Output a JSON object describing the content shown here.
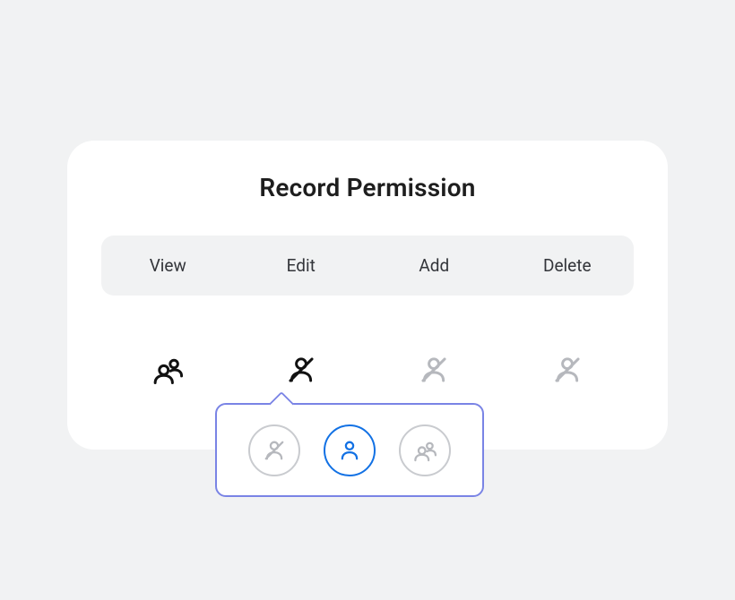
{
  "title": "Record Permission",
  "columns": {
    "view": {
      "label": "View"
    },
    "edit": {
      "label": "Edit"
    },
    "add": {
      "label": "Add"
    },
    "delete": {
      "label": "Delete"
    }
  },
  "values": {
    "view": {
      "icon": "group",
      "color": "dark"
    },
    "edit": {
      "icon": "person-slash",
      "color": "dark",
      "popover_open": true
    },
    "add": {
      "icon": "person-slash",
      "color": "muted"
    },
    "delete": {
      "icon": "person-slash",
      "color": "muted"
    }
  },
  "popover_options": [
    {
      "icon": "person-slash",
      "selected": false
    },
    {
      "icon": "person",
      "selected": true
    },
    {
      "icon": "group",
      "selected": false
    }
  ],
  "colors": {
    "dark": "#111111",
    "muted": "#b6b8bd",
    "accent": "#1271e4",
    "border": "#7a84e5"
  }
}
